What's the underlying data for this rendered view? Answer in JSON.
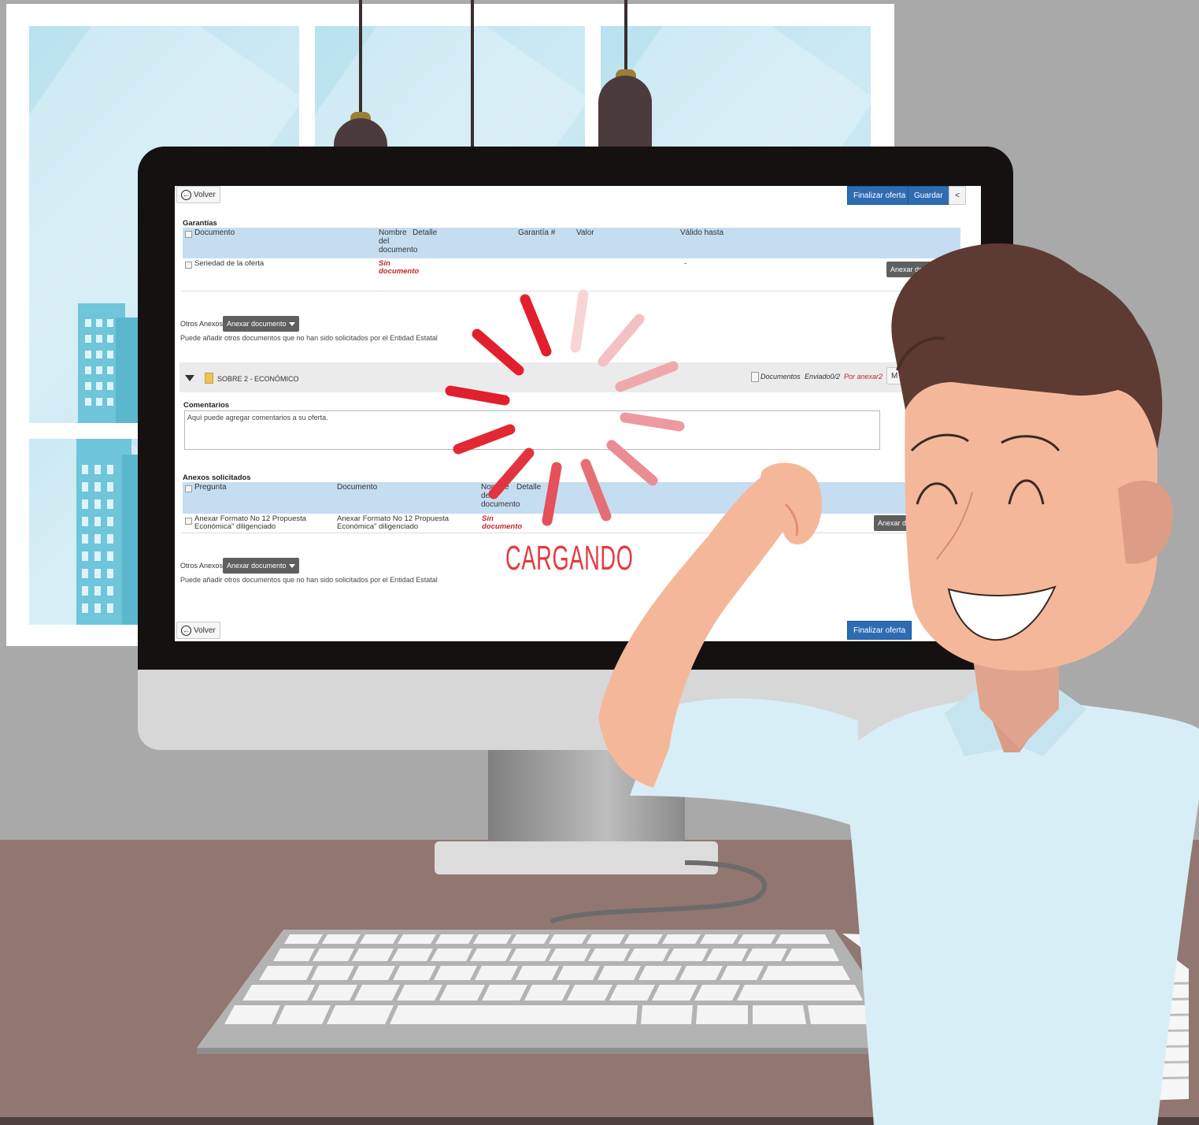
{
  "screen": {
    "back_label": "Volver",
    "finalize_label": "Finalizar oferta",
    "save_label": "Guardar",
    "collapse_label": "<",
    "garantias": {
      "title": "Garantías",
      "headers": [
        "Documento",
        "Nombre del documento",
        "Detalle",
        "Garantía #",
        "Valor",
        "Válido hasta"
      ],
      "row": {
        "documento": "Seriedad de la oferta",
        "nombre": "Sin documento",
        "valido_hasta": "-",
        "action_label": "Anexar documentos"
      }
    },
    "otros_anexos_1": {
      "label": "Otros Anexos:",
      "button_label": "Anexar documento",
      "note": "Puede añadir otros documentos que no han sido solicitados por el Entidad Estatal"
    },
    "sobre": {
      "title": "SOBRE 2 - ECONÓMICO",
      "docs_label": "Documentos",
      "enviado": "Enviado0/2",
      "por_anexar": "Por anexar2",
      "btn_label": "M"
    },
    "comentarios": {
      "title": "Comentarios",
      "placeholder": "Aquí puede agregar comentarios a su oferta."
    },
    "anexos": {
      "title": "Anexos solicitados",
      "headers": [
        "Pregunta",
        "Documento",
        "Nombre del documento",
        "Detalle"
      ],
      "row": {
        "pregunta": "Anexar Formato No 12 Propuesta Económica\" diligenciado",
        "documento": "Anexar Formato No 12 Propuesta Económica\" diligenciado",
        "nombre": "Sin documento",
        "action_label": "Anexar do"
      }
    },
    "otros_anexos_2": {
      "label": "Otros Anexos:",
      "button_label": "Anexar documento",
      "note": "Puede añadir otros documentos que no han sido solicitados por el Entidad Estatal"
    },
    "footer_back_label": "Volver",
    "footer_finalize_label": "Finalizar oferta"
  },
  "loading": {
    "text": "CARGANDO",
    "color": "#e53a3f"
  },
  "colors": {
    "wall": "#a9a9a9",
    "desk": "#917671",
    "button_blue": "#2d6cb3",
    "table_header": "#c5ddf1"
  },
  "icons": [
    "back-arrow-icon",
    "checkbox-icon",
    "folder-icon",
    "document-icon",
    "caret-down-icon",
    "loading-spinner-icon"
  ]
}
